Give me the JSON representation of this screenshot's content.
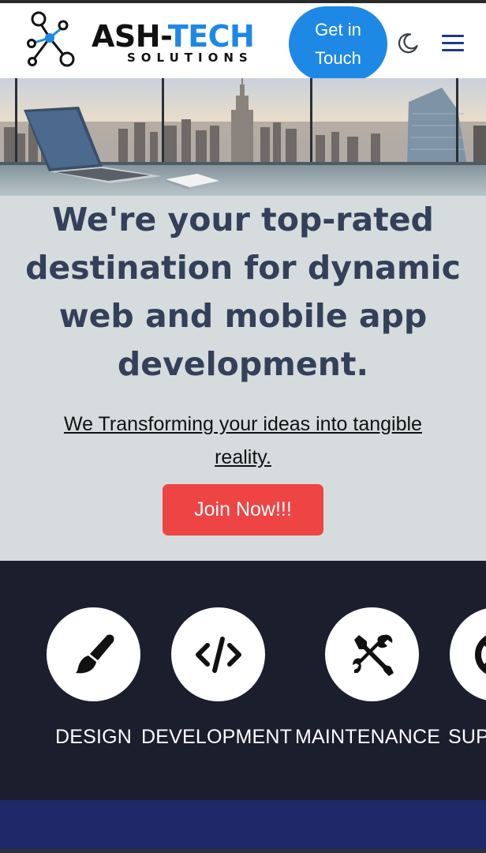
{
  "header": {
    "brand_part1": "ASH-",
    "brand_part2": "TECH",
    "brand_sub": "SOLUTIONS",
    "cta_label": "Get in Touch",
    "icons": [
      "logo-network-icon",
      "moon-icon",
      "hamburger-menu-icon"
    ]
  },
  "hero": {
    "headline": "We're your top-rated destination for dynamic web and mobile app development.",
    "subline": "We Transforming your ideas into tangible reality.",
    "join_label": "Join Now!!!"
  },
  "services": {
    "items": [
      {
        "label": "DESIGN",
        "icon": "paintbrush-icon"
      },
      {
        "label": "DEVELOPMENT",
        "icon": "code-icon"
      },
      {
        "label": "MAINTENANCE",
        "icon": "tools-icon"
      },
      {
        "label": "SUPPORT",
        "icon": "lifebuoy-icon"
      }
    ]
  },
  "colors": {
    "accent_blue": "#1e88e5",
    "join_red": "#ef4444",
    "headline_navy": "#34405a",
    "hero_bg": "#d6dcdd",
    "services_bg": "#1b1e2c",
    "bottom_band": "#1f2868"
  }
}
